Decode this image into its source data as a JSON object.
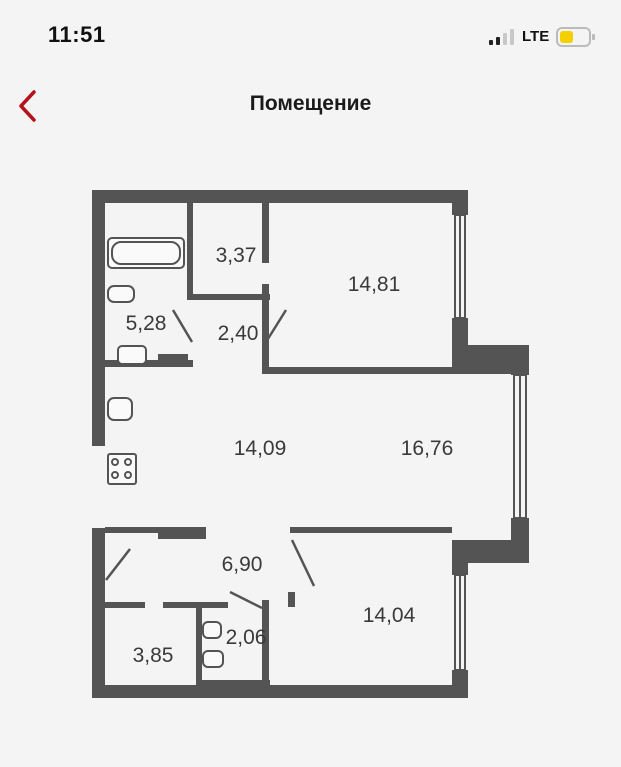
{
  "status_bar": {
    "time": "11:51",
    "network": "LTE",
    "battery_color": "#f5d000"
  },
  "nav": {
    "title": "Помещение",
    "back_icon": "chevron-left-icon",
    "accent_color": "#b5121b"
  },
  "floor_plan": {
    "wall_color": "#545454",
    "rooms": {
      "bathroom": "5,28",
      "storage": "3,37",
      "corridor_top": "2,40",
      "bedroom_top": "14,81",
      "kitchen": "14,09",
      "living_room": "16,76",
      "hall": "6,90",
      "wardrobe": "3,85",
      "toilet": "2,06",
      "bedroom_bottom": "14,04"
    }
  }
}
